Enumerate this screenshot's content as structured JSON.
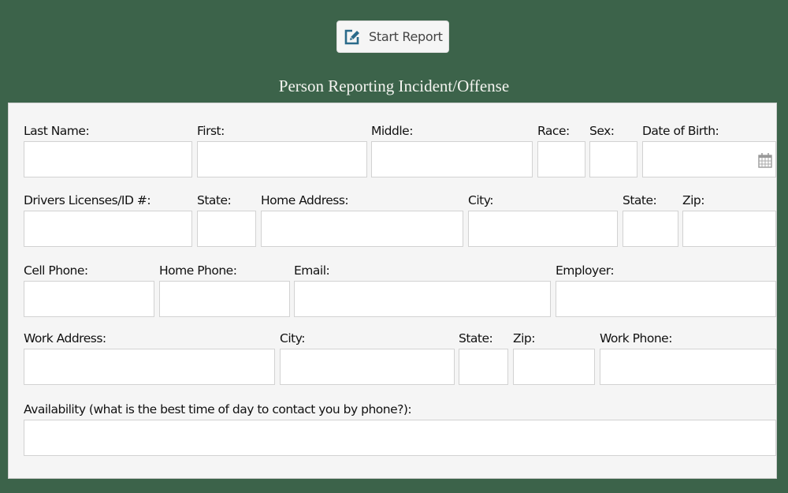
{
  "toolbar": {
    "start_report_label": "Start Report",
    "start_report_icon": "edit-icon",
    "icon_color": "#2a6a8a"
  },
  "section": {
    "title": "Person Reporting Incident/Offense"
  },
  "form": {
    "last_name": {
      "label": "Last Name:",
      "value": ""
    },
    "first": {
      "label": "First:",
      "value": ""
    },
    "middle": {
      "label": "Middle:",
      "value": ""
    },
    "race": {
      "label": "Race:",
      "value": ""
    },
    "sex": {
      "label": "Sex:",
      "value": ""
    },
    "dob": {
      "label": "Date of Birth:",
      "value": "",
      "icon": "calendar-icon"
    },
    "drivers_license": {
      "label": "Drivers Licenses/ID #:",
      "value": ""
    },
    "dl_state": {
      "label": "State:",
      "value": ""
    },
    "home_address": {
      "label": "Home Address:",
      "value": ""
    },
    "home_city": {
      "label": "City:",
      "value": ""
    },
    "home_state": {
      "label": "State:",
      "value": ""
    },
    "home_zip": {
      "label": "Zip:",
      "value": ""
    },
    "cell_phone": {
      "label": "Cell Phone:",
      "value": ""
    },
    "home_phone": {
      "label": "Home Phone:",
      "value": ""
    },
    "email": {
      "label": "Email:",
      "value": ""
    },
    "employer": {
      "label": "Employer:",
      "value": ""
    },
    "work_address": {
      "label": "Work Address:",
      "value": ""
    },
    "work_city": {
      "label": "City:",
      "value": ""
    },
    "work_state": {
      "label": "State:",
      "value": ""
    },
    "work_zip": {
      "label": "Zip:",
      "value": ""
    },
    "work_phone": {
      "label": "Work Phone:",
      "value": ""
    },
    "availability": {
      "label": "Availability (what is the best time of day to contact you by phone?):",
      "value": ""
    }
  }
}
